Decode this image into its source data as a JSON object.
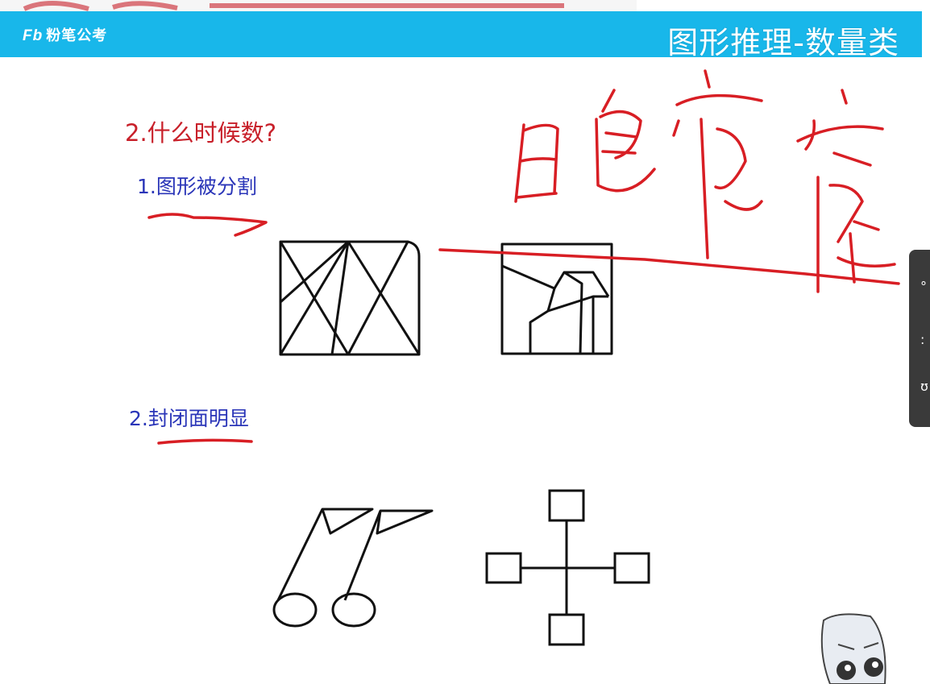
{
  "header": {
    "logo_mark": "Fb",
    "logo_text": "粉笔公考",
    "title": "图形推理-数量类"
  },
  "question": {
    "title": "2.什么时候数?"
  },
  "points": [
    {
      "label": "1.图形被分割"
    },
    {
      "label": "2.封闭面明显"
    }
  ],
  "colors": {
    "header_blue": "#18b7ea",
    "question_red": "#c8202a",
    "point_blue": "#2a35b8",
    "annotation_red": "#d81e24",
    "figure_black": "#111111"
  },
  "icons": {
    "overlay_panel": "playback-sidebar",
    "mascot": "mascot-character-icon"
  }
}
